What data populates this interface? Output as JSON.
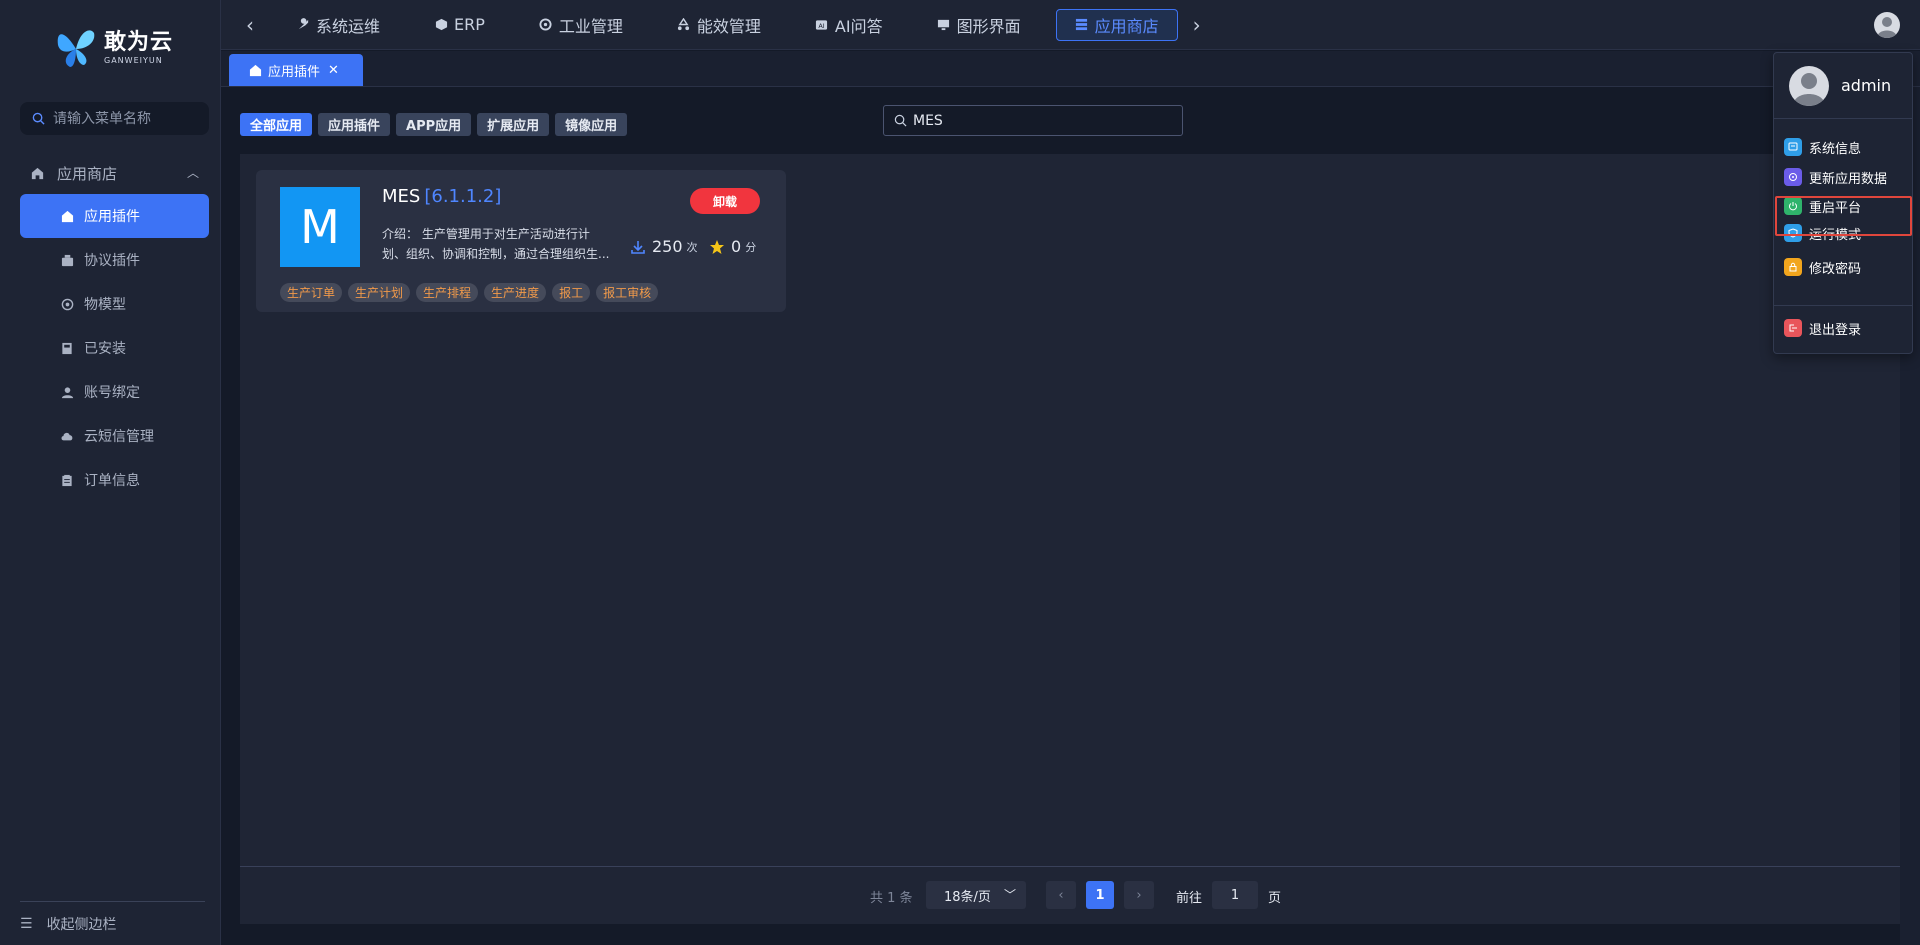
{
  "brand": {
    "name": "敢为云",
    "sub": "GANWEIYUN"
  },
  "sidebar": {
    "search_placeholder": "请输入菜单名称",
    "group_label": "应用商店",
    "items": [
      {
        "label": "应用插件",
        "icon": "store-icon",
        "active": true
      },
      {
        "label": "协议插件",
        "icon": "plugin-icon"
      },
      {
        "label": "物模型",
        "icon": "model-icon"
      },
      {
        "label": "已安装",
        "icon": "installed-icon"
      },
      {
        "label": "账号绑定",
        "icon": "user-icon"
      },
      {
        "label": "云短信管理",
        "icon": "cloud-icon"
      },
      {
        "label": "订单信息",
        "icon": "order-icon"
      }
    ],
    "collapse_label": "收起侧边栏"
  },
  "topnav": {
    "tabs": [
      {
        "label": "系统运维",
        "icon": "wrench-icon"
      },
      {
        "label": "ERP",
        "icon": "cube-icon"
      },
      {
        "label": "工业管理",
        "icon": "gear-icon"
      },
      {
        "label": "能效管理",
        "icon": "recycle-icon"
      },
      {
        "label": "AI问答",
        "icon": "ai-icon"
      },
      {
        "label": "图形界面",
        "icon": "monitor-icon"
      },
      {
        "label": "应用商店",
        "icon": "stack-icon",
        "active": true
      }
    ]
  },
  "page_tab": {
    "label": "应用插件"
  },
  "filters": [
    "全部应用",
    "应用插件",
    "APP应用",
    "扩展应用",
    "镜像应用"
  ],
  "search": {
    "value": "MES"
  },
  "card": {
    "logo_letter": "M",
    "name": "MES",
    "version": "[6.1.1.2]",
    "desc_line1": "介绍：  生产管理用于对生产活动进行计",
    "desc_line2": "划、组织、协调和控制，通过合理组织生...",
    "action": "卸载",
    "downloads": "250",
    "downloads_unit": "次",
    "rating": "0",
    "rating_unit": "分",
    "tags": [
      "生产订单",
      "生产计划",
      "生产排程",
      "生产进度",
      "报工",
      "报工审核"
    ]
  },
  "pager": {
    "total": "共 1 条",
    "page_size": "18条/页",
    "current": "1",
    "goto_label": "前往",
    "goto_value": "1",
    "page_label": "页"
  },
  "user_menu": {
    "username": "admin",
    "items": [
      {
        "label": "系统信息",
        "color": "#2f9ee8"
      },
      {
        "label": "更新应用数据",
        "color": "#6b5ce8"
      },
      {
        "label": "重启平台",
        "color": "#2fb36b"
      },
      {
        "label": "运行模式",
        "color": "#2f9ee8"
      },
      {
        "label": "修改密码",
        "color": "#f2a51d"
      },
      {
        "label": "退出登录",
        "color": "#e9555b"
      }
    ]
  },
  "colors": {
    "accent": "#3d73f5",
    "danger": "#f1353e",
    "tag_text": "#f19a4a"
  }
}
